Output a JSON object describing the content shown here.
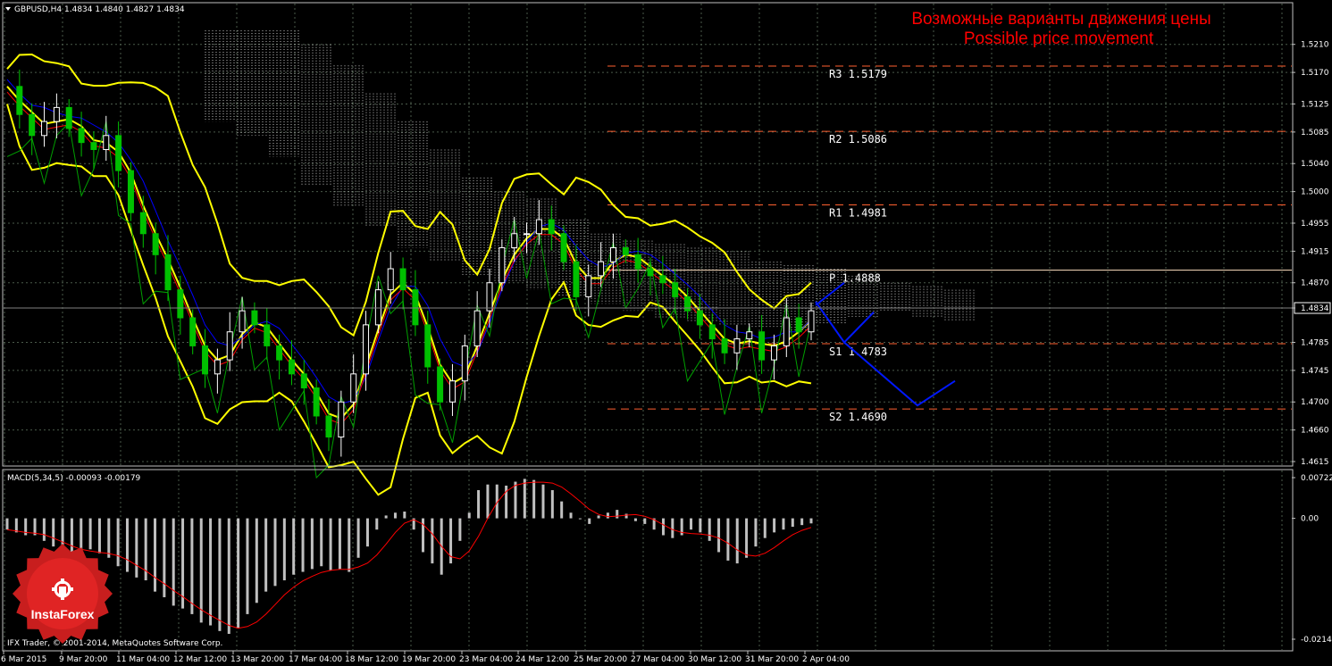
{
  "window": {
    "symbol_header": "GBPUSD,H4  1.4834 1.4840 1.4827 1.4834",
    "macd_header": "MACD(5,34,5) -0.00093 -0.00179",
    "copyright": "IFX Trader, © 2001-2014, MetaQuotes Software Corp.",
    "title_ru": "Возможные варианты движения цены",
    "title_en": "Possible price movement",
    "logo_text": "InstaForex"
  },
  "colors": {
    "background": "#000000",
    "grid": "#4a5a4a",
    "bull_candle": "#ffffff",
    "bear_candle": "#00c000",
    "bands": "#ffff00",
    "ma_blue": "#0000ff",
    "ma_red": "#ff0000",
    "rsi_green": "#00a000",
    "levels": "#ff6030",
    "pivot": "#ffe0c0",
    "macd_hist": "#c0c0c0",
    "macd_signal": "#ff0000",
    "forecast": "#0018ff",
    "title": "#ff0000"
  },
  "chart_data": [
    {
      "type": "candlestick",
      "symbol": "GBPUSD",
      "timeframe": "H4",
      "ylim": [
        1.4615,
        1.523
      ],
      "yticks": [
        "1.5210",
        "1.5170",
        "1.5125",
        "1.5085",
        "1.5040",
        "1.5000",
        "1.4955",
        "1.4915",
        "1.4870",
        "1.4834",
        "1.4785",
        "1.4745",
        "1.4700",
        "1.4660",
        "1.4615"
      ],
      "current_price": "1.4834",
      "xticks": [
        "6 Mar 2015",
        "9 Mar 20:00",
        "11 Mar 04:00",
        "12 Mar 12:00",
        "13 Mar 20:00",
        "17 Mar 04:00",
        "18 Mar 12:00",
        "19 Mar 20:00",
        "23 Mar 04:00",
        "24 Mar 12:00",
        "25 Mar 20:00",
        "27 Mar 04:00",
        "30 Mar 12:00",
        "31 Mar 20:00",
        "2 Apr 04:00"
      ],
      "levels": [
        {
          "name": "R3",
          "label": "R3 1.5179",
          "value": 1.5179
        },
        {
          "name": "R2",
          "label": "R2 1.5086",
          "value": 1.5086
        },
        {
          "name": "R1",
          "label": "R1 1.4981",
          "value": 1.4981
        },
        {
          "name": "P",
          "label": "P 1.4888",
          "value": 1.4888
        },
        {
          "name": "S1",
          "label": "S1 1.4783",
          "value": 1.4783
        },
        {
          "name": "S2",
          "label": "S2 1.4690",
          "value": 1.469
        }
      ],
      "close_path": [
        1.515,
        1.511,
        1.508,
        1.51,
        1.512,
        1.509,
        1.507,
        1.506,
        1.508,
        1.503,
        1.497,
        1.494,
        1.491,
        1.486,
        1.482,
        1.478,
        1.474,
        1.476,
        1.48,
        1.483,
        1.481,
        1.478,
        1.476,
        1.474,
        1.472,
        1.468,
        1.465,
        1.47,
        1.474,
        1.481,
        1.486,
        1.489,
        1.486,
        1.481,
        1.475,
        1.47,
        1.473,
        1.478,
        1.483,
        1.487,
        1.492,
        1.494,
        1.494,
        1.496,
        1.494,
        1.49,
        1.485,
        1.488,
        1.49,
        1.492,
        1.491,
        1.489,
        1.488,
        1.487,
        1.485,
        1.483,
        1.481,
        1.479,
        1.477,
        1.479,
        1.48,
        1.476,
        1.478,
        1.482,
        1.48,
        1.483
      ],
      "forecast_path": [
        1.4838,
        1.487,
        1.4828,
        1.4785,
        1.482,
        1.478,
        1.4695,
        1.473
      ],
      "pivot_forecast": [
        1.4838,
        1.487,
        1.4828,
        1.4785,
        1.482
      ]
    },
    {
      "type": "bar",
      "name": "MACD(5,34,5)",
      "ylim": [
        -0.02145,
        0.00722
      ],
      "yticks": [
        "0.00722",
        "0.00",
        "-0.02145"
      ],
      "values": [
        -0.002,
        -0.0025,
        -0.003,
        -0.003,
        -0.004,
        -0.005,
        -0.006,
        -0.0065,
        -0.006,
        -0.0055,
        -0.0062,
        -0.007,
        -0.0085,
        -0.0095,
        -0.0105,
        -0.011,
        -0.013,
        -0.014,
        -0.0155,
        -0.016,
        -0.017,
        -0.0185,
        -0.019,
        -0.02,
        -0.0205,
        -0.0195,
        -0.017,
        -0.015,
        -0.013,
        -0.012,
        -0.011,
        -0.01,
        -0.0095,
        -0.009,
        -0.0085,
        -0.0092,
        -0.009,
        -0.0095,
        -0.007,
        -0.005,
        -0.002,
        0.0005,
        0.001,
        0.0012,
        -0.002,
        -0.006,
        -0.008,
        -0.01,
        -0.008,
        -0.004,
        0.001,
        0.005,
        0.006,
        0.006,
        0.0058,
        0.0065,
        0.007,
        0.0068,
        0.006,
        0.005,
        0.003,
        0.001,
        0.0,
        -0.001,
        0.0005,
        0.001,
        0.0015,
        0.0008,
        -0.0005,
        -0.001,
        -0.002,
        -0.003,
        -0.0035,
        -0.003,
        -0.002,
        -0.0025,
        -0.004,
        -0.006,
        -0.0075,
        -0.008,
        -0.007,
        -0.005,
        -0.0035,
        -0.0025,
        -0.002,
        -0.0015,
        -0.0012,
        -0.0009
      ]
    }
  ]
}
